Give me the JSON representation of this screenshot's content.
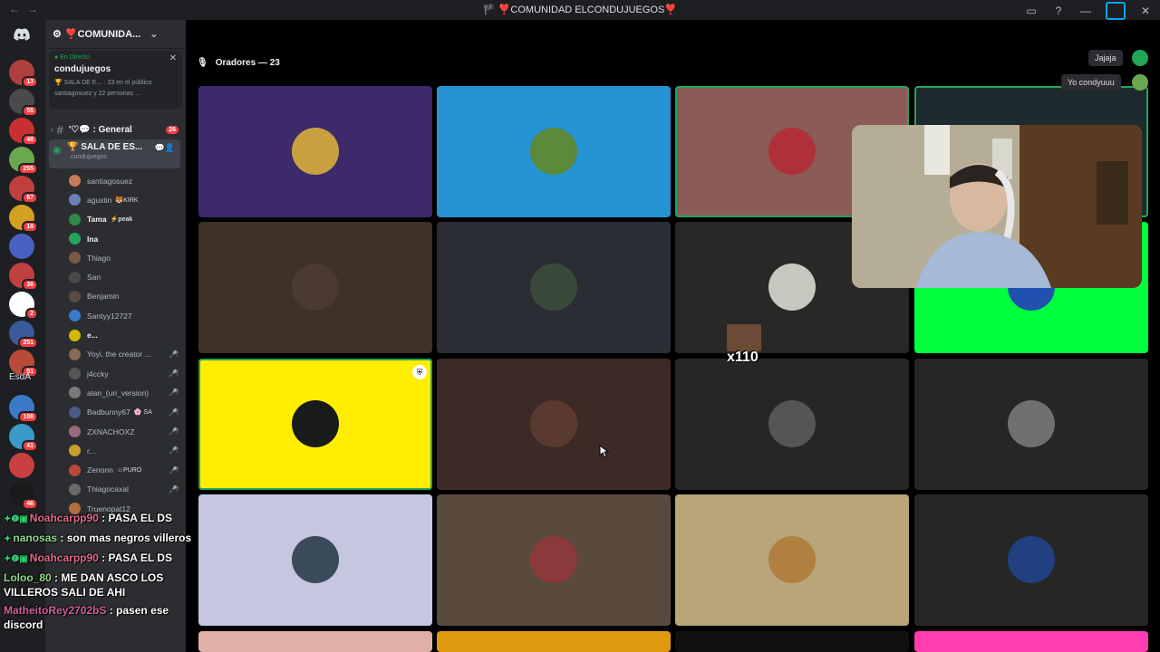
{
  "titlebar": {
    "title": "🏴 ❣️COMUNIDAD ELCONDUJUEGOS❣️",
    "back": "←",
    "forward": "→",
    "inbox_icon": "inbox-icon",
    "help_icon": "?",
    "minimize": "—",
    "close": "✕"
  },
  "guilds": {
    "badges": [
      "13",
      "55",
      "48",
      "255",
      "67",
      "18",
      "",
      "36",
      "2",
      "251",
      "51",
      "108",
      "41",
      "",
      "46"
    ],
    "label": "EsdA"
  },
  "server": {
    "name": "❣️COMUNIDA...",
    "live": {
      "status": "En Directo",
      "streamer": "condujuegos",
      "info": "🏆 SALA DE E... · 23 en el público",
      "viewers": "santiagosuez y 22 personas ..."
    },
    "general": {
      "label": "'♡💬 : General",
      "count": "26"
    },
    "voice_channel": {
      "name": "🏆 SALA DE ES...",
      "sub": "condujuegos"
    },
    "members": [
      {
        "name": "santiagosuez",
        "tag": "",
        "muted": false,
        "bold": false,
        "color": "#c97a5a"
      },
      {
        "name": "agustin",
        "tag": "🐯KIRK",
        "muted": false,
        "bold": false,
        "color": "#6b7fb8"
      },
      {
        "name": "Tama",
        "tag": "⚡peak",
        "muted": false,
        "bold": true,
        "color": "#2e8a4a"
      },
      {
        "name": "Ina",
        "tag": "",
        "muted": false,
        "bold": true,
        "color": "#23a55a"
      },
      {
        "name": "Thiago",
        "tag": "",
        "muted": false,
        "bold": false,
        "color": "#7a5a44"
      },
      {
        "name": "San",
        "tag": "",
        "muted": false,
        "bold": false,
        "color": "#4a4a4a"
      },
      {
        "name": "Benjamin",
        "tag": "",
        "muted": false,
        "bold": false,
        "color": "#5a4a44"
      },
      {
        "name": "Santyy12727",
        "tag": "",
        "muted": false,
        "bold": false,
        "color": "#3a7ac8"
      },
      {
        "name": "e...",
        "tag": "",
        "muted": false,
        "bold": true,
        "color": "#d4b800"
      },
      {
        "name": "Yoyi, the creator ...",
        "tag": "",
        "muted": true,
        "bold": false,
        "color": "#8a6a54"
      },
      {
        "name": "j4ccky",
        "tag": "",
        "muted": true,
        "bold": false,
        "color": "#555555"
      },
      {
        "name": "alan_(uri_version)",
        "tag": "",
        "muted": true,
        "bold": false,
        "color": "#7a7a7a"
      },
      {
        "name": "Badbunny67",
        "tag": "🌸 SA",
        "muted": true,
        "bold": false,
        "color": "#4a5a88"
      },
      {
        "name": "ZXNACHOXZ",
        "tag": "",
        "muted": true,
        "bold": false,
        "color": "#9a6a7a"
      },
      {
        "name": "r...",
        "tag": "",
        "muted": true,
        "bold": false,
        "color": "#c8a030"
      },
      {
        "name": "Zenonn",
        "tag": "☺PURO",
        "muted": true,
        "bold": false,
        "color": "#b84a3a"
      },
      {
        "name": "Thiagocaxal",
        "tag": "",
        "muted": true,
        "bold": false,
        "color": "#6a6a6a"
      },
      {
        "name": "Truenopat12",
        "tag": "",
        "muted": false,
        "bold": false,
        "color": "#b07040"
      }
    ]
  },
  "stage": {
    "speakers_label": "Oradores — 23",
    "tiles": [
      {
        "bg": "#3d2a6b",
        "avatar": "#c8a040",
        "speaking": false,
        "shield": false
      },
      {
        "bg": "#2593d4",
        "avatar": "#5a8a3a",
        "speaking": false,
        "shield": false
      },
      {
        "bg": "#8a5b57",
        "avatar": "#b0303a",
        "speaking": true,
        "shield": false
      },
      {
        "bg": "#1e2b2e",
        "avatar": "#2a3a40",
        "speaking": true,
        "shield": false
      },
      {
        "bg": "#3d3128",
        "avatar": "#4a3a30",
        "speaking": false,
        "shield": false
      },
      {
        "bg": "#2a2d33",
        "avatar": "#3a4a3a",
        "speaking": false,
        "shield": false
      },
      {
        "bg": "#2a2826",
        "avatar": "#c8c8c0",
        "speaking": false,
        "shield": false
      },
      {
        "bg": "#00ff3c",
        "avatar": "#2050b0",
        "speaking": false,
        "shield": false
      },
      {
        "bg": "#ffee00",
        "avatar": "#1a1a1a",
        "speaking": true,
        "shield": true
      },
      {
        "bg": "#3d2a26",
        "avatar": "#5a3a30",
        "speaking": false,
        "shield": false
      },
      {
        "bg": "#262626",
        "avatar": "#555555",
        "speaking": false,
        "shield": false
      },
      {
        "bg": "#262626",
        "avatar": "#707070",
        "speaking": false,
        "shield": false
      },
      {
        "bg": "#c4c7dd",
        "avatar": "#3a4a5a",
        "speaking": false,
        "shield": false
      },
      {
        "bg": "#5a4a3e",
        "avatar": "#8a3a3a",
        "speaking": false,
        "shield": false
      },
      {
        "bg": "#b8a67a",
        "avatar": "#b08040",
        "speaking": false,
        "shield": false
      },
      {
        "bg": "#262626",
        "avatar": "#204080",
        "speaking": false,
        "shield": false
      },
      {
        "bg": "#e0b0a8",
        "avatar": "",
        "speaking": false,
        "shield": false
      },
      {
        "bg": "#e09a10",
        "avatar": "",
        "speaking": false,
        "shield": false
      },
      {
        "bg": "#111111",
        "avatar": "",
        "speaking": false,
        "shield": false
      },
      {
        "bg": "#ff3cb0",
        "avatar": "",
        "speaking": false,
        "shield": false
      }
    ]
  },
  "chips": {
    "chip1": "Jajaja",
    "chip2": "Yo condyuuu"
  },
  "overlay": {
    "sticker_count": "x110"
  },
  "chat": [
    {
      "badges": "✦❶▣",
      "user": "Noahcarpp90",
      "text": ": PASA EL DS",
      "cls": "user1"
    },
    {
      "badges": "✦",
      "user": "nanosas",
      "text": ": son mas negros villeros",
      "cls": "user2"
    },
    {
      "badges": "✦❶▣",
      "user": "Noahcarpp90",
      "text": ": PASA EL DS",
      "cls": "user1"
    },
    {
      "badges": "",
      "user": "Loloo_80",
      "text": ": ME DAN ASCO LOS VILLEROS SALI DE AHI",
      "cls": "user2"
    },
    {
      "badges": "",
      "user": "MatheitoRey2702bS",
      "text": ": pasen ese discord",
      "cls": "user4"
    }
  ],
  "colors": {
    "accent_green": "#23a55a",
    "discord_blurple": "#5865f2",
    "danger": "#f23f42"
  }
}
